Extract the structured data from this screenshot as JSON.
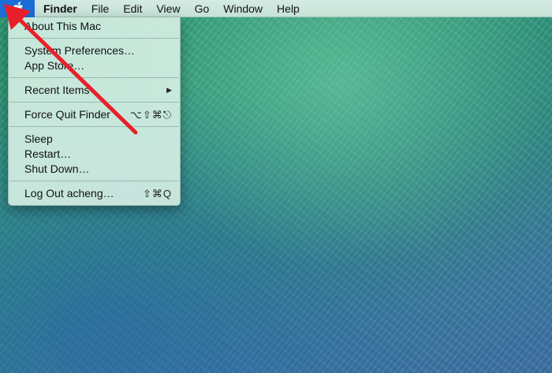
{
  "menubar": {
    "apple_icon": "apple-icon",
    "items": [
      {
        "label": "Finder"
      },
      {
        "label": "File"
      },
      {
        "label": "Edit"
      },
      {
        "label": "View"
      },
      {
        "label": "Go"
      },
      {
        "label": "Window"
      },
      {
        "label": "Help"
      }
    ]
  },
  "apple_menu": {
    "about": "About This Mac",
    "system_preferences": "System Preferences…",
    "app_store": "App Store…",
    "recent_items": "Recent Items",
    "force_quit": "Force Quit Finder",
    "force_quit_shortcut": "⌥⇧⌘⎋",
    "sleep": "Sleep",
    "restart": "Restart…",
    "shut_down": "Shut Down…",
    "log_out": "Log Out acheng…",
    "log_out_shortcut": "⇧⌘Q"
  },
  "colors": {
    "apple_menu_highlight": "#1b6ed8",
    "annotation_arrow": "#e8202a"
  }
}
